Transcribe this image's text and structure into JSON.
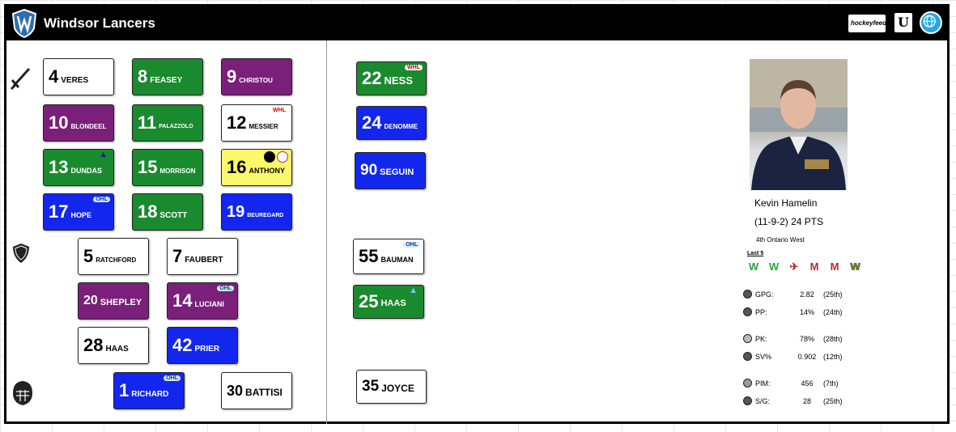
{
  "header": {
    "team_name": "Windsor Lancers",
    "hf_logo_text": "hockeyfeed",
    "u_logo_text": "U"
  },
  "lines": {
    "forwards_row1": [
      {
        "number": "4",
        "name": "VERES",
        "color": "white"
      },
      {
        "number": "8",
        "name": "FEASEY",
        "color": "green"
      },
      {
        "number": "9",
        "name": "CHRISTOU",
        "color": "purple"
      }
    ],
    "forwards_row2": [
      {
        "number": "10",
        "name": "BLONDEEL",
        "color": "purple"
      },
      {
        "number": "11",
        "name": "PALAZZOLO",
        "color": "green"
      },
      {
        "number": "12",
        "name": "MESSIER",
        "color": "white"
      }
    ],
    "forwards_row3": [
      {
        "number": "13",
        "name": "DUNDAS",
        "color": "green"
      },
      {
        "number": "15",
        "name": "MORRISON",
        "color": "green"
      },
      {
        "number": "16",
        "name": "ANTHONY",
        "color": "yellow"
      }
    ],
    "forwards_row4": [
      {
        "number": "17",
        "name": "HOPE",
        "color": "blue"
      },
      {
        "number": "18",
        "name": "SCOTT",
        "color": "green"
      },
      {
        "number": "19",
        "name": "BEUREGARD",
        "color": "blue"
      }
    ],
    "defense_row1": [
      {
        "number": "5",
        "name": "RATCHFORD",
        "color": "white"
      },
      {
        "number": "7",
        "name": "FAUBERT",
        "color": "white"
      }
    ],
    "defense_row2": [
      {
        "number": "20",
        "name": "SHEPLEY",
        "color": "purple"
      },
      {
        "number": "14",
        "name": "LUCIANI",
        "color": "purple"
      }
    ],
    "defense_row3": [
      {
        "number": "28",
        "name": "HAAS",
        "color": "white"
      },
      {
        "number": "42",
        "name": "PRIER",
        "color": "blue"
      }
    ],
    "goalies": [
      {
        "number": "1",
        "name": "RICHARD",
        "color": "blue"
      },
      {
        "number": "30",
        "name": "BATTISI",
        "color": "white"
      }
    ]
  },
  "extras": [
    {
      "number": "22",
      "name": "NESS",
      "color": "green"
    },
    {
      "number": "24",
      "name": "DENOMME",
      "color": "blue"
    },
    {
      "number": "90",
      "name": "SEGUIN",
      "color": "blue"
    },
    {
      "number": "55",
      "name": "BAUMAN",
      "color": "white"
    },
    {
      "number": "25",
      "name": "HAAS",
      "color": "green"
    },
    {
      "number": "35",
      "name": "JOYCE",
      "color": "white"
    }
  ],
  "tags": {
    "ohl": "OHL",
    "whl": "WHL"
  },
  "coach": {
    "name": "Kevin Hamelin",
    "record": "(11-9-2) 24 PTS",
    "standing": "4th Ontario West",
    "last5_label": "Last 5",
    "last5": [
      {
        "symbol": "W",
        "result": "win"
      },
      {
        "symbol": "W",
        "result": "win"
      },
      {
        "symbol": "✈",
        "result": "loss"
      },
      {
        "symbol": "M",
        "result": "loss"
      },
      {
        "symbol": "M",
        "result": "loss"
      },
      {
        "symbol": "W",
        "result": "loss"
      }
    ]
  },
  "stats": [
    {
      "label": "GPG:",
      "value": "2.82",
      "rank": "(25th)"
    },
    {
      "label": "PP:",
      "value": "14%",
      "rank": "(24th)"
    },
    {
      "label": "PK:",
      "value": "78%",
      "rank": "(28th)"
    },
    {
      "label": "SV%",
      "value": "0.902",
      "rank": "(12th)"
    },
    {
      "label": "PIM:",
      "value": "456",
      "rank": "(7th)"
    },
    {
      "label": "S/G:",
      "value": "28",
      "rank": "(25th)"
    }
  ],
  "colors": {
    "green": "#1a8a2e",
    "purple": "#7a1f7a",
    "blue": "#1326ee",
    "yellow": "#fbf96a",
    "white": "#ffffff",
    "win": "#2aa43a",
    "loss": "#c0262d"
  }
}
